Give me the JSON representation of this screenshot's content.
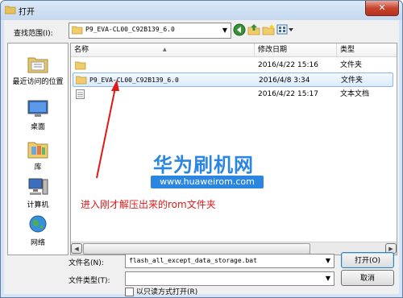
{
  "window": {
    "title": "打开",
    "close_glyph": "✕"
  },
  "lookin": {
    "label": "查找范围(I):",
    "value": "P9_EVA-CL00_C92B139_6.0"
  },
  "places": [
    {
      "label": "最近访问的位置",
      "icon": "recent-places-icon"
    },
    {
      "label": "桌面",
      "icon": "desktop-icon"
    },
    {
      "label": "库",
      "icon": "libraries-icon"
    },
    {
      "label": "计算机",
      "icon": "computer-icon"
    },
    {
      "label": "网络",
      "icon": "network-icon"
    }
  ],
  "columns": {
    "name": "名称",
    "date": "修改日期",
    "type": "类型"
  },
  "files": [
    {
      "name": "",
      "date": "2016/4/22 15:16",
      "type": "文件夹",
      "icon": "folder-icon",
      "selected": false
    },
    {
      "name": "P9_EVA-CL00_C92B139_6.0",
      "date": "2016/4/8 3:34",
      "type": "文件夹",
      "icon": "folder-icon",
      "selected": true
    },
    {
      "name": "",
      "date": "2016/4/22 15:17",
      "type": "文本文档",
      "icon": "text-file-icon",
      "selected": false
    }
  ],
  "filename": {
    "label": "文件名(N):",
    "value": "flash_all_except_data_storage.bat"
  },
  "filetype": {
    "label": "文件类型(T):",
    "value": ""
  },
  "readonly": {
    "label": "以只读方式打开(R)"
  },
  "buttons": {
    "open": "打开(O)",
    "cancel": "取消"
  },
  "watermark": {
    "brand": "华为刷机网",
    "url": "www.huaweirom.com"
  },
  "annotation": "进入刚才解压出来的rom文件夹",
  "colors": {
    "accent": "#2a86e0",
    "annotation": "#e01818",
    "selection": "#dcebfc"
  }
}
